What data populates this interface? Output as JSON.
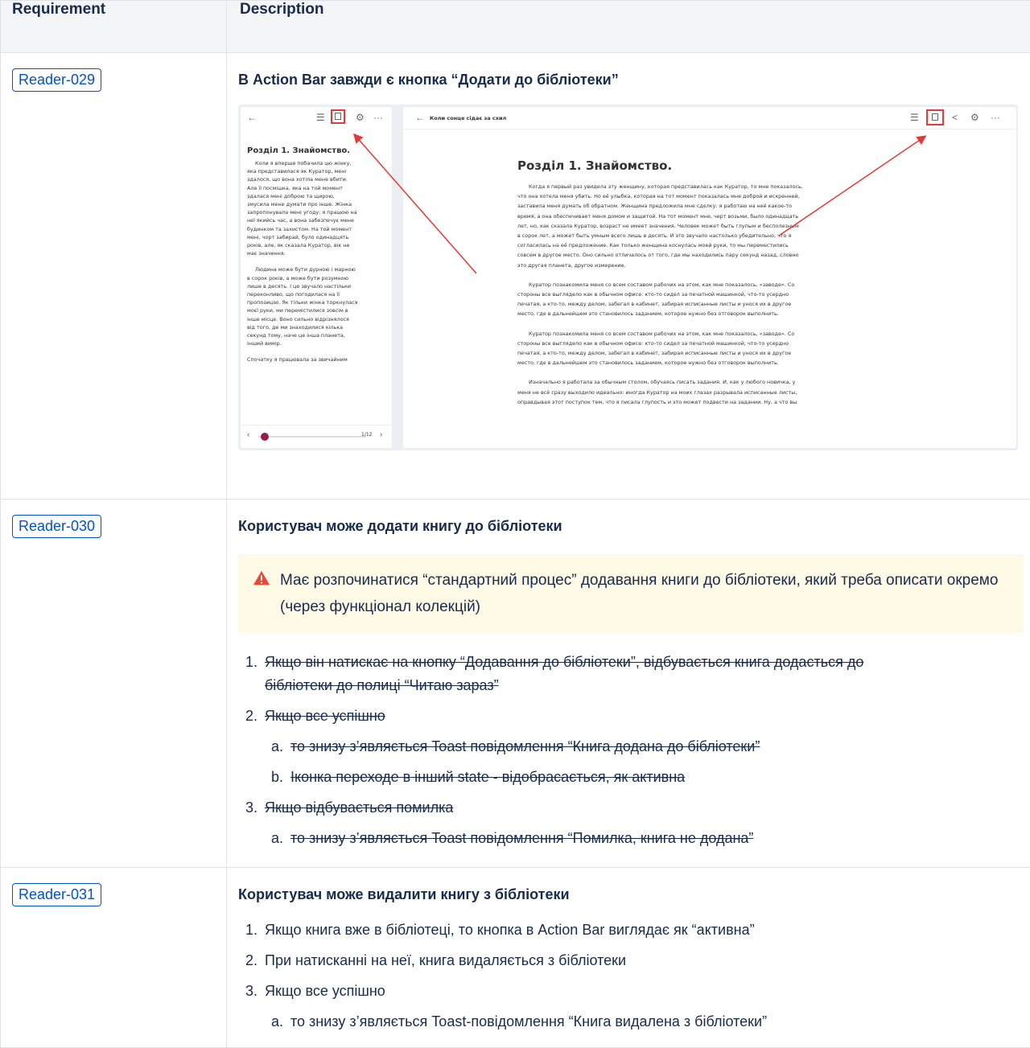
{
  "table": {
    "headers": {
      "requirement": "Requirement",
      "description": "Description"
    }
  },
  "rows": [
    {
      "id": "Reader-029",
      "title": "В Action Bar завжди є кнопка “Додати до бібліотеки”",
      "screenshot": {
        "left_panel": {
          "chapter": "Розділ 1. Знайомство.",
          "para1": [
            "Коли я вперше побачила цю жінку,",
            "яка представилася як Куратор, мені",
            "здалося, що вона хотіла мене вбити.",
            "Але її посмішка, яка на той момент",
            "здалася мені доброю та щирою,",
            "змусила мене думати про інше. Жінка",
            "запропонувала мені угоду: я працюю на",
            "неї якийсь час, а вона забезпечує мене",
            "будинком та захистом. На той момент",
            "мені, чорт забирай, було одинадцять",
            "років, але, як сказала Куратор, вік не",
            "має значення."
          ],
          "para2": [
            "Людина може бути дурною і марною",
            "в сорок років, а може бути розумною",
            "лише в десять. І це звучало настільки",
            "переконливо, що погодилася на її",
            "пропозицію. Як тільки жінка торкнулася",
            "моєї руки, ми перемістилися зовсім в",
            "інше місце. Воно сильно відрізнялося",
            "від того, де ми знаходилися кілька",
            "секунд тому, наче це інша планета,",
            "інший вимір."
          ],
          "para3": "Спочатку я працювала за звичайним",
          "page_indicator": "1/12"
        },
        "right_panel": {
          "book_title": "Коли сонце сідає за схил",
          "chapter": "Розділ 1. Знайомство.",
          "para1": [
            "Когда я первый раз увидела эту женщину, которая представилась как Куратор, то мне показалось,",
            "что она хотела меня убить. Но её улыбка, которая на тот момент показалась мне доброй и искренней,",
            "заставила меня думать об обратном. Женщина предложила мне сделку: я работаю на неё какое-то",
            "время, а она обеспечивает меня домом и защитой. На тот момент мне, черт возьми, было одинадцать",
            "лет, но, как сказала Куратор, возраст не имеет значения. Человек может быть глупым и бесполезным",
            "в сорок лет, а может быть умным всего лишь в десять. И это звучало настолько убедительно, что я",
            "согласилась на её предложение. Как только женщина коснулась моей руки, то мы переместились",
            "совсем в другое место. Оно сильно отличалось от того, где мы находились пару секунд назад, словно",
            "это другая планета, другое измерение."
          ],
          "para2": [
            "Куратор познакомила меня со всем составом рабочих на этом, как мне показалось, «заводе». Со",
            "стороны все выглядело как в обычном офисе: кто-то сидел за печатной машинкой, что-то усердно",
            "печатая, а кто-то, между делом, забегал в кабинет, забирая исписанные листы и унося их в другое",
            "место, где в дальнейшем это становилось заданием, которое нужно без отговорок выполнить."
          ],
          "para3": [
            "Куратор познакомила меня со всем составом рабочих на этом, как мне показалось, «заводе». Со",
            "стороны все выглядело как в обычном офисе: кто-то сидел за печатной машинкой, что-то усердно",
            "печатая, а кто-то, между делом, забегал в кабинет, забирая исписанные листы и унося их в другое",
            "место, где в дальнейшем это становилось заданием, которое нужно без отговорок выполнить."
          ],
          "para4": [
            "Изначально я работала за обычным столом, обучаясь писать задания. И, как у любого новичка, у",
            "меня не всё сразу выходило идеально: иногда Куратор на моих глазах разрывала исписанные листы,",
            "оправдывая этот поступок тем, что я писала глупость и это может подвести на задании. Ну, а что вы"
          ]
        },
        "highlight_color": "#e53935"
      }
    },
    {
      "id": "Reader-030",
      "title": "Користувач може додати книгу до бібліотеки",
      "warning": "Має розпочинатися “стандартний процес” додавання книги до бібліотеки, який треба описати окремо (через функціонал колекцій)",
      "items": [
        {
          "num": "1.",
          "text": "Якщо він натискає на кнопку “Додавання до бібліотеки”, відбувається книга додасться до",
          "text2": "бібліотеки до полиці “Читаю зараз”"
        },
        {
          "num": "2.",
          "text": "Якщо все успішно",
          "sub": [
            {
              "num": "a.",
              "text": "то знизу з’являється Toast повідомлення “Книга додана до бібліотеки”"
            },
            {
              "num": "b.",
              "text": "Іконка переходе в інший state - відобрасається, як активна"
            }
          ]
        },
        {
          "num": "3.",
          "text": "Якщо відбувається помилка",
          "sub": [
            {
              "num": "a.",
              "text": "то знизу з’являється Toast повідомлення “Помилка, книга не додана”"
            }
          ]
        }
      ]
    },
    {
      "id": "Reader-031",
      "title": "Користувач може видалити книгу з бібліотеки",
      "items": [
        {
          "num": "1.",
          "text": "Якщо книга вже в бібліотеці, то кнопка в Action Bar виглядає як “активна”"
        },
        {
          "num": "2.",
          "text": "При натисканні на неї, книга видаляється з бібліотеки"
        },
        {
          "num": "3.",
          "text": "Якщо все успішно",
          "sub": [
            {
              "num": "a.",
              "text": "то знизу з’являється Toast-повідомлення “Книга видалена з бібліотеки”"
            }
          ]
        }
      ]
    }
  ],
  "colors": {
    "link": "#0052cc",
    "header_bg": "#f4f5f7",
    "warning_bg": "#fffae6",
    "warning_icon": "#e5493a",
    "border": "#dfe1e6"
  }
}
